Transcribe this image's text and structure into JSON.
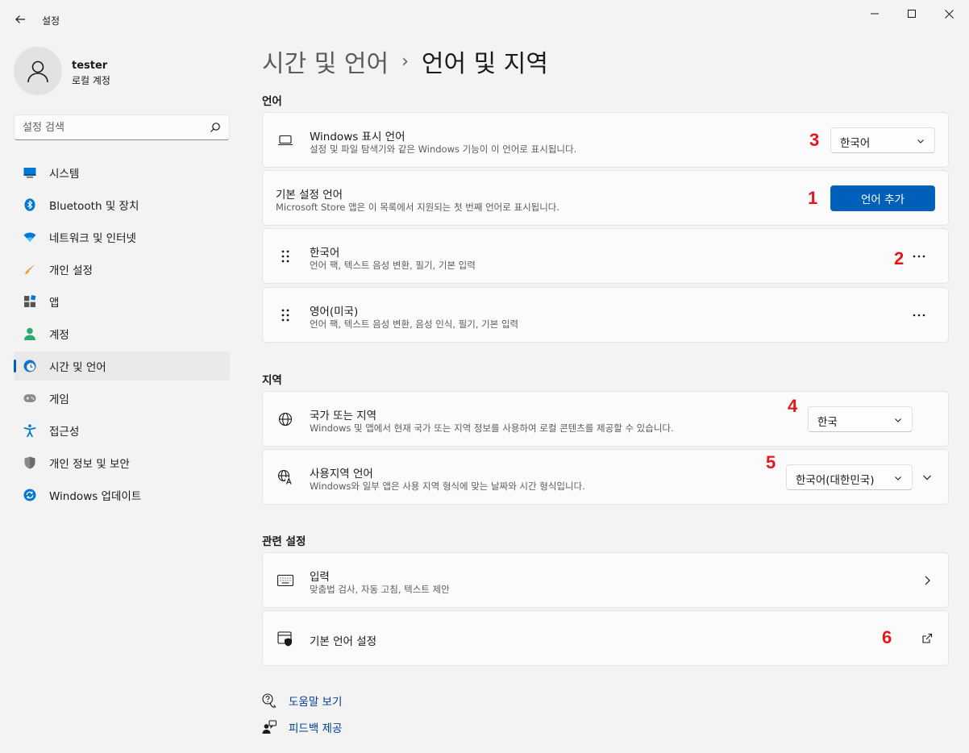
{
  "window": {
    "title": "설정"
  },
  "profile": {
    "name": "tester",
    "account_type": "로컬 계정"
  },
  "search": {
    "placeholder": "설정 검색"
  },
  "sidebar": {
    "items": [
      {
        "label": "시스템",
        "icon": "monitor-icon"
      },
      {
        "label": "Bluetooth 및 장치",
        "icon": "bluetooth-icon"
      },
      {
        "label": "네트워크 및 인터넷",
        "icon": "wifi-icon"
      },
      {
        "label": "개인 설정",
        "icon": "brush-icon"
      },
      {
        "label": "앱",
        "icon": "apps-icon"
      },
      {
        "label": "계정",
        "icon": "person-icon"
      },
      {
        "label": "시간 및 언어",
        "icon": "clock-globe-icon",
        "active": true
      },
      {
        "label": "게임",
        "icon": "gamepad-icon"
      },
      {
        "label": "접근성",
        "icon": "accessibility-icon"
      },
      {
        "label": "개인 정보 및 보안",
        "icon": "shield-icon"
      },
      {
        "label": "Windows 업데이트",
        "icon": "update-icon"
      }
    ]
  },
  "breadcrumb": {
    "parent": "시간 및 언어",
    "separator": "›",
    "current": "언어 및 지역"
  },
  "sections": {
    "language": "언어",
    "region": "지역",
    "related": "관련 설정"
  },
  "language": {
    "display_title": "Windows 표시 언어",
    "display_desc": "설정 및 파일 탐색기와 같은 Windows 기능이 이 언어로 표시됩니다.",
    "display_value": "한국어",
    "preferred_title": "기본 설정 언어",
    "preferred_desc": "Microsoft Store 앱은 이 목록에서 지원되는 첫 번째 언어로 표시됩니다.",
    "add_button": "언어 추가",
    "list": [
      {
        "name": "한국어",
        "features": "언어 팩, 텍스트 음성 변환, 필기, 기본 입력"
      },
      {
        "name": "영어(미국)",
        "features": "언어 팩, 텍스트 음성 변환, 음성 인식, 필기, 기본 입력"
      }
    ],
    "more_glyph": "···"
  },
  "region": {
    "country_title": "국가 또는 지역",
    "country_desc": "Windows 및 앱에서 현재 국가 또는 지역 정보를 사용하여 로컬 콘텐츠를 제공할 수 있습니다.",
    "country_value": "한국",
    "format_title": "사용지역 언어",
    "format_desc": "Windows와 일부 앱은 사용 지역 형식에 맞는 날짜와 시간 형식입니다.",
    "format_value": "한국어(대한민국)"
  },
  "related": {
    "typing_title": "입력",
    "typing_desc": "맞춤법 검사, 자동 고침, 텍스트 제안",
    "admin_title": "기본 언어 설정"
  },
  "markers": [
    "1",
    "2",
    "3",
    "4",
    "5",
    "6"
  ],
  "footer": {
    "help": "도움말 보기",
    "feedback": "피드백 제공"
  },
  "colors": {
    "accent": "#005fb8",
    "marker": "#e3161b",
    "link": "#003e92"
  }
}
